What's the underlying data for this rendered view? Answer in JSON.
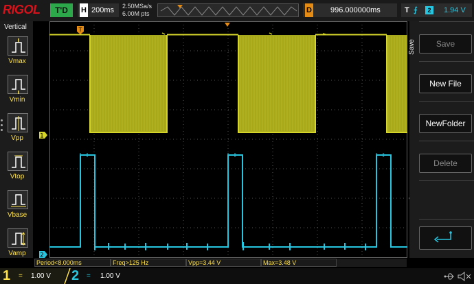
{
  "brand": "RIGOL",
  "mode_badge": "T'D",
  "timebase": {
    "key": "H",
    "value": "200ms"
  },
  "sample": {
    "rate": "2.50MSa/s",
    "points": "6.00M pts"
  },
  "delay": {
    "key": "D",
    "value": "996.000000ms"
  },
  "trigger": {
    "key": "T",
    "source": "2",
    "level": "1.94 V"
  },
  "measure_panel": {
    "title": "Vertical",
    "items": [
      {
        "label": "Vmax",
        "icon": "vmax-icon"
      },
      {
        "label": "Vmin",
        "icon": "vmin-icon"
      },
      {
        "label": "Vpp",
        "icon": "vpp-icon"
      },
      {
        "label": "Vtop",
        "icon": "vtop-icon"
      },
      {
        "label": "Vbase",
        "icon": "vbase-icon"
      },
      {
        "label": "Vamp",
        "icon": "vamp-icon"
      }
    ]
  },
  "save_menu": {
    "title": "Save",
    "items": [
      {
        "label": "Save",
        "enabled": false
      },
      {
        "label": "New File",
        "enabled": true
      },
      {
        "label": "NewFolder",
        "enabled": true
      },
      {
        "label": "Delete",
        "enabled": false
      }
    ],
    "return_icon": "return-arrow-icon"
  },
  "markers": {
    "ch1": "1",
    "ch2": "2",
    "trigger_level": "T",
    "trigger_pos": "T"
  },
  "measurements": [
    {
      "label": "Period<8.000ms"
    },
    {
      "label": "Freq>125 Hz"
    },
    {
      "label": "Vpp=3.44 V"
    },
    {
      "label": "Max=3.48 V"
    }
  ],
  "channels": [
    {
      "num": "1",
      "coupling": "=",
      "scale": "1.00 V",
      "color": "#ffe24a"
    },
    {
      "num": "2",
      "coupling": "=",
      "scale": "1.00 V",
      "color": "#27c6e0"
    }
  ],
  "colors": {
    "ch1": "#d6d62a",
    "ch2": "#27c6e0",
    "accent": "#e58a12"
  }
}
